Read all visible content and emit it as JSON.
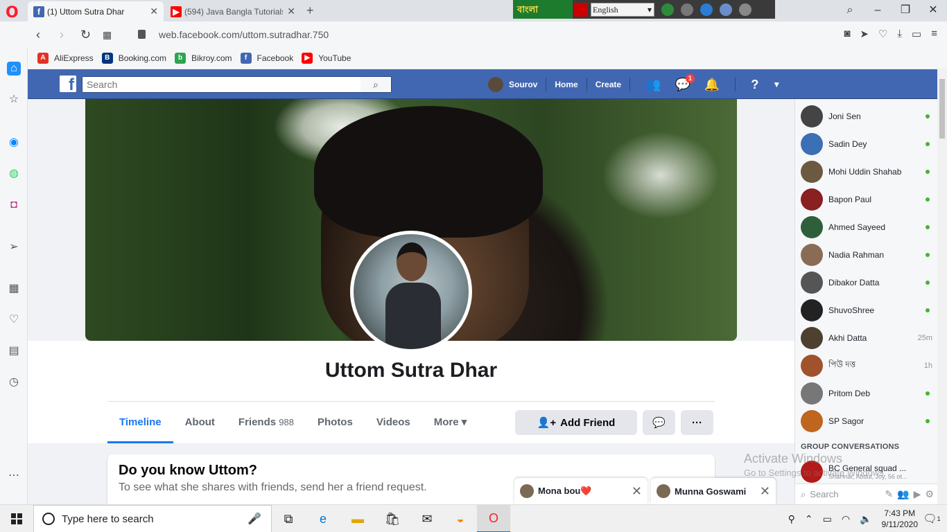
{
  "browser": {
    "tabs": [
      {
        "title": "(1) Uttom Sutra Dhar",
        "favicon": "facebook-icon"
      },
      {
        "title": "(594) Java Bangla Tutorials",
        "favicon": "youtube-icon"
      }
    ],
    "url": "web.facebook.com/uttom.sutradhar.750",
    "language_strip": {
      "bangla_label": "বাংলা",
      "language_value": "English"
    },
    "bookmarks": [
      {
        "label": "AliExpress",
        "color": "#e43225",
        "icon": "aliexpress-icon"
      },
      {
        "label": "Booking.com",
        "color": "#003580",
        "icon": "booking-icon"
      },
      {
        "label": "Bikroy.com",
        "color": "#2ea44f",
        "icon": "bikroy-icon"
      },
      {
        "label": "Facebook",
        "color": "#4267b2",
        "icon": "facebook-icon"
      },
      {
        "label": "YouTube",
        "color": "#ff0000",
        "icon": "youtube-icon"
      }
    ]
  },
  "facebook": {
    "search_placeholder": "Search",
    "nav": {
      "user_name": "Sourov",
      "home_label": "Home",
      "create_label": "Create",
      "messenger_badge": "1"
    },
    "profile": {
      "name": "Uttom Sutra Dhar",
      "tabs": [
        {
          "label": "Timeline"
        },
        {
          "label": "About"
        },
        {
          "label": "Friends",
          "count": "988"
        },
        {
          "label": "Photos"
        },
        {
          "label": "Videos"
        },
        {
          "label": "More ▾"
        }
      ],
      "add_friend_label": "Add Friend"
    },
    "know_card": {
      "title": "Do you know Uttom?",
      "text": "To see what she shares with friends, send her a friend request."
    },
    "chat": {
      "contacts": [
        {
          "name": "Joni Sen",
          "status": "online"
        },
        {
          "name": "Sadin Dey",
          "status": "online"
        },
        {
          "name": "Mohi Uddin Shahab",
          "status": "online"
        },
        {
          "name": "Bapon Paul",
          "status": "online"
        },
        {
          "name": "Ahmed Sayeed",
          "status": "online"
        },
        {
          "name": "Nadia Rahman",
          "status": "online"
        },
        {
          "name": "Dibakor Datta",
          "status": "online"
        },
        {
          "name": "ShuvoShree",
          "status": "online"
        },
        {
          "name": "Akhi Datta",
          "status": "25m"
        },
        {
          "name": "পিউ দত্ত",
          "status": "1h"
        },
        {
          "name": "Pritom Deb",
          "status": "online"
        },
        {
          "name": "SP Sagor",
          "status": "online"
        }
      ],
      "group_header": "GROUP CONVERSATIONS",
      "group": {
        "title": "BC General squad ...",
        "subtitle": "ShaHriar, Abdul, Joy, 56 ot..."
      },
      "search_placeholder": "Search"
    },
    "chat_tabs": [
      {
        "name": "Mona bou❤️"
      },
      {
        "name": "Munna Goswami"
      }
    ],
    "watermark": {
      "line1": "Activate Windows",
      "line2": "Go to Settings to activate Windows."
    }
  },
  "taskbar": {
    "search_placeholder": "Type here to search",
    "time": "7:43 PM",
    "date": "9/11/2020",
    "notification_count": "1"
  }
}
